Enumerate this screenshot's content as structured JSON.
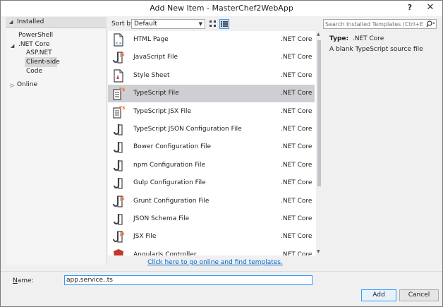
{
  "window": {
    "title": "Add New Item - MasterChef2WebApp",
    "help_glyph": "?",
    "close_glyph": "✕"
  },
  "sidebar": {
    "installed_label": "Installed",
    "items": [
      {
        "label": "PowerShell"
      },
      {
        "label": ".NET Core"
      },
      {
        "label": "ASP.NET"
      },
      {
        "label": "Client-side"
      },
      {
        "label": "Code"
      },
      {
        "label": "Online"
      }
    ]
  },
  "toolbar": {
    "sort_label": "Sort by:",
    "sort_value": "Default",
    "search_placeholder": "Search Installed Templates (Ctrl+E)"
  },
  "templates": {
    "items": [
      {
        "name": "HTML Page",
        "category": ".NET Core",
        "icon": "html-page-icon"
      },
      {
        "name": "JavaScript File",
        "category": ".NET Core",
        "icon": "javascript-file-icon"
      },
      {
        "name": "Style Sheet",
        "category": ".NET Core",
        "icon": "stylesheet-icon"
      },
      {
        "name": "TypeScript File",
        "category": ".NET Core",
        "icon": "typescript-file-icon"
      },
      {
        "name": "TypeScript JSX File",
        "category": ".NET Core",
        "icon": "typescript-jsx-file-icon"
      },
      {
        "name": "TypeScript JSON Configuration File",
        "category": ".NET Core",
        "icon": "typescript-json-config-icon"
      },
      {
        "name": "Bower Configuration File",
        "category": ".NET Core",
        "icon": "bower-config-icon"
      },
      {
        "name": "npm Configuration File",
        "category": ".NET Core",
        "icon": "npm-config-icon"
      },
      {
        "name": "Gulp Configuration File",
        "category": ".NET Core",
        "icon": "gulp-config-icon"
      },
      {
        "name": "Grunt Configuration File",
        "category": ".NET Core",
        "icon": "grunt-config-icon"
      },
      {
        "name": "JSON Schema File",
        "category": ".NET Core",
        "icon": "json-schema-icon"
      },
      {
        "name": "JSX File",
        "category": ".NET Core",
        "icon": "jsx-file-icon"
      },
      {
        "name": "AngularJs Controller",
        "category": ".NET Core",
        "icon": "angular-icon"
      }
    ],
    "online_link": "Click here to go online and find templates."
  },
  "details": {
    "type_label": "Type:",
    "type_value": ".NET Core",
    "description": "A blank TypeScript source file"
  },
  "footer": {
    "name_label_prefix": "N",
    "name_label_rest": "ame:",
    "name_value": "app.service..ts",
    "add_label": "Add",
    "cancel_label": "Cancel"
  },
  "colors": {
    "accent": "#3399ff",
    "selected_row": "#cfcfd3",
    "link": "#0066cc",
    "js_orange": "#e8672a"
  }
}
